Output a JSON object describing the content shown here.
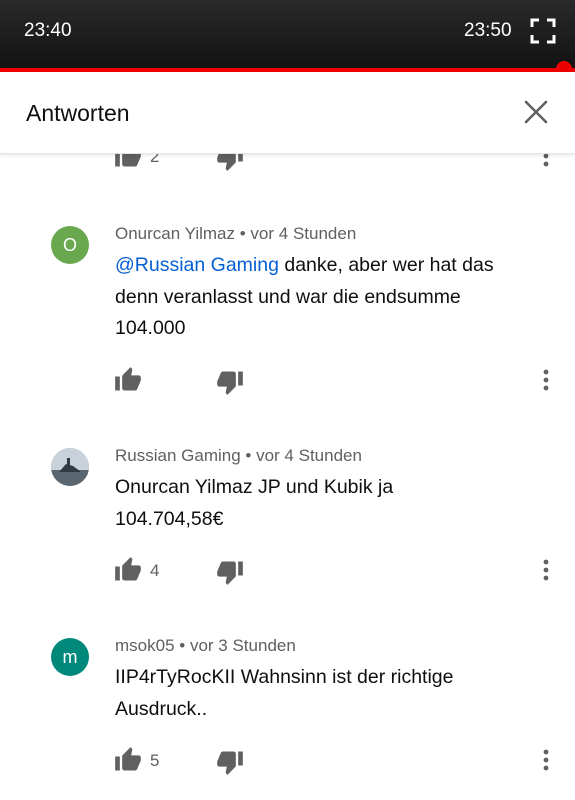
{
  "player": {
    "current_time": "23:40",
    "duration": "23:50",
    "fullscreen_icon": "fullscreen-icon",
    "progress_color": "#ee0000"
  },
  "header": {
    "title": "Antworten",
    "close_icon": "close-icon"
  },
  "partial_action_row": {
    "like_count": "2"
  },
  "comments": [
    {
      "avatar_letter": "O",
      "avatar_color": "#6aa84f",
      "author": "Onurcan Yilmaz",
      "separator": "•",
      "time": "vor 4 Stunden",
      "mention": "@Russian Gaming",
      "text_line1": " danke, aber wer hat das",
      "text_line2": "denn veranlasst und war die endsumme",
      "text_line3": "104.000",
      "like_count": ""
    },
    {
      "avatar_letter": "",
      "avatar_color": "#9aa6b2",
      "author": "Russian Gaming",
      "separator": "•",
      "time": "vor 4 Stunden",
      "text_line1": "Onurcan Yilmaz JP und Kubik ja",
      "text_line2": "104.704,58€",
      "like_count": "4"
    },
    {
      "avatar_letter": "m",
      "avatar_color": "#00897b",
      "author": "msok05",
      "separator": "•",
      "time": "vor 3 Stunden",
      "text_line1": "IIP4rTyRocKII Wahnsinn ist der richtige",
      "text_line2": "Ausdruck..",
      "like_count": "5"
    }
  ],
  "icons": {
    "like": "thumbs-up-icon",
    "dislike": "thumbs-down-icon",
    "more": "more-vert-icon"
  }
}
